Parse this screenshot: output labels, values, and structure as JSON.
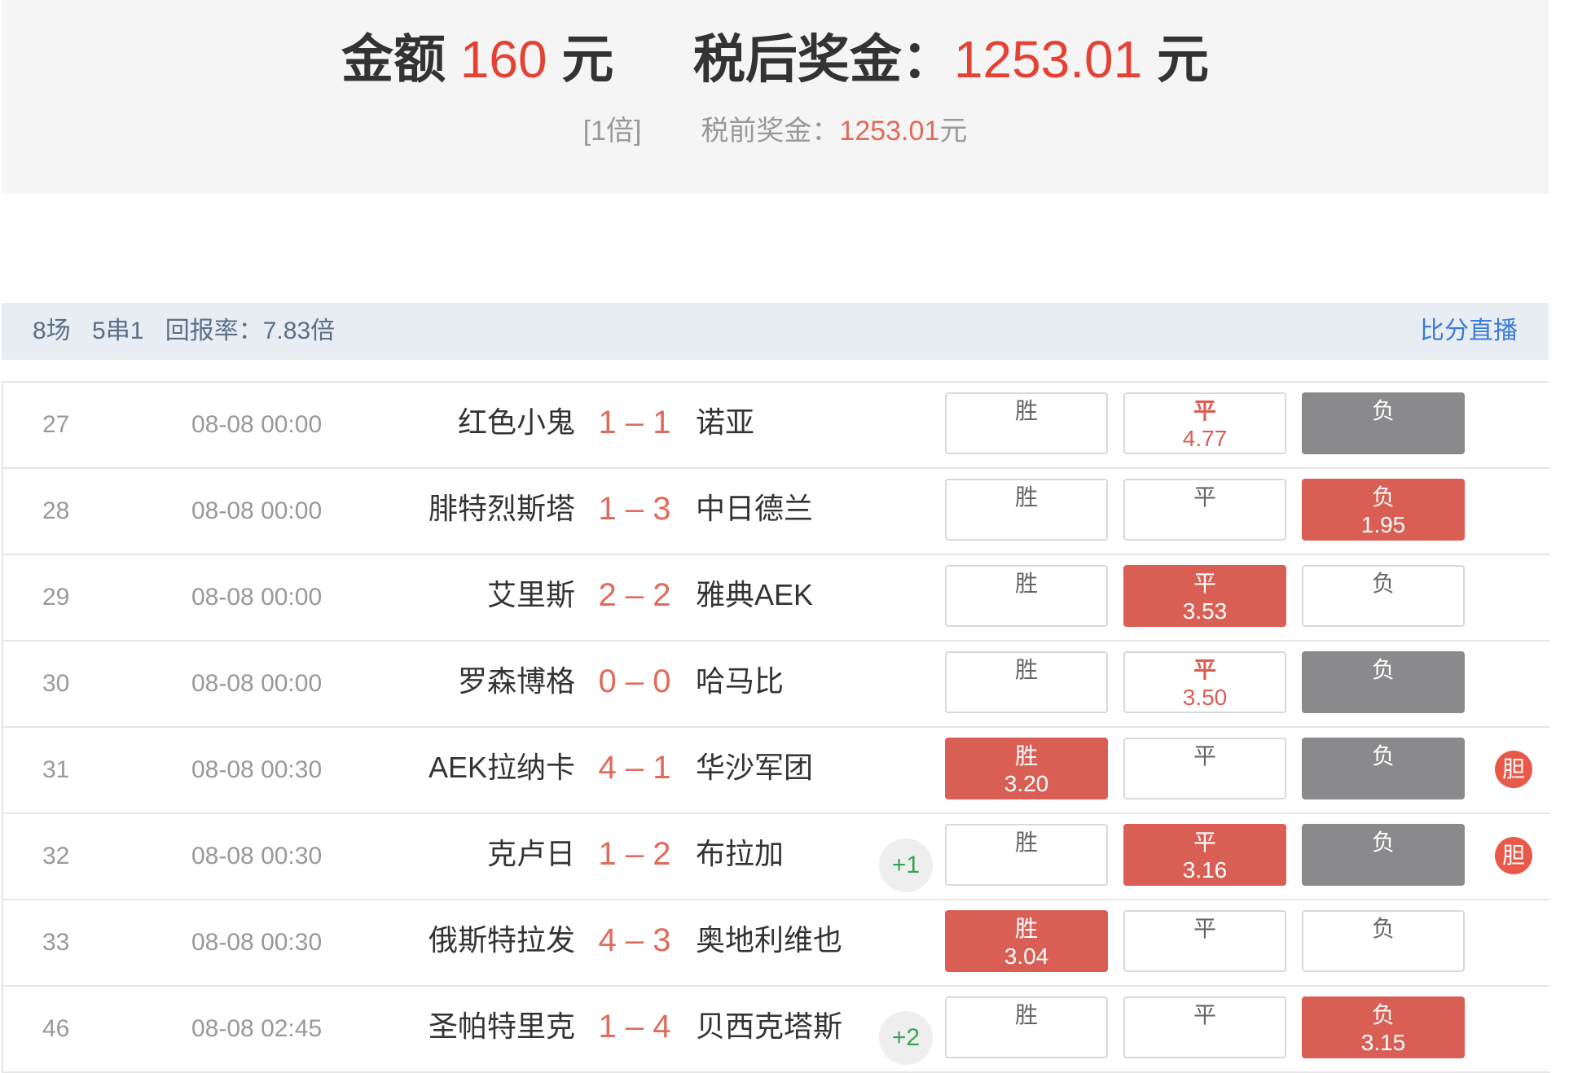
{
  "summary": {
    "amount_label": "金额",
    "amount": "160",
    "amount_unit": "元",
    "after_tax_label": "税后奖金：",
    "after_tax": "1253.01",
    "after_tax_unit": "元",
    "multiple": "[1倍]",
    "pre_tax_label": "税前奖金：",
    "pre_tax": "1253.01",
    "pre_tax_unit": "元"
  },
  "infobar": {
    "matches": "8场",
    "mode": "5串1",
    "return_rate": "回报率：7.83倍",
    "live_link": "比分直播"
  },
  "matches": [
    {
      "num": "27",
      "time": "08-08 00:00",
      "home": "红色小鬼",
      "score": "1 – 1",
      "away": "诺亚",
      "plus": "",
      "win": {
        "label": "胜",
        "odds": "",
        "state": "none"
      },
      "draw": {
        "label": "平",
        "odds": "4.77",
        "state": "odds"
      },
      "lose": {
        "label": "负",
        "odds": "",
        "state": "result"
      },
      "dan": ""
    },
    {
      "num": "28",
      "time": "08-08 00:00",
      "home": "腓特烈斯塔",
      "score": "1 – 3",
      "away": "中日德兰",
      "plus": "",
      "win": {
        "label": "胜",
        "odds": "",
        "state": "none"
      },
      "draw": {
        "label": "平",
        "odds": "",
        "state": "none"
      },
      "lose": {
        "label": "负",
        "odds": "1.95",
        "state": "hit"
      },
      "dan": ""
    },
    {
      "num": "29",
      "time": "08-08 00:00",
      "home": "艾里斯",
      "score": "2 – 2",
      "away": "雅典AEK",
      "plus": "",
      "win": {
        "label": "胜",
        "odds": "",
        "state": "none"
      },
      "draw": {
        "label": "平",
        "odds": "3.53",
        "state": "hit"
      },
      "lose": {
        "label": "负",
        "odds": "",
        "state": "none"
      },
      "dan": ""
    },
    {
      "num": "30",
      "time": "08-08 00:00",
      "home": "罗森博格",
      "score": "0 – 0",
      "away": "哈马比",
      "plus": "",
      "win": {
        "label": "胜",
        "odds": "",
        "state": "none"
      },
      "draw": {
        "label": "平",
        "odds": "3.50",
        "state": "odds"
      },
      "lose": {
        "label": "负",
        "odds": "",
        "state": "result"
      },
      "dan": ""
    },
    {
      "num": "31",
      "time": "08-08 00:30",
      "home": "AEK拉纳卡",
      "score": "4 – 1",
      "away": "华沙军团",
      "plus": "",
      "win": {
        "label": "胜",
        "odds": "3.20",
        "state": "hit"
      },
      "draw": {
        "label": "平",
        "odds": "",
        "state": "none"
      },
      "lose": {
        "label": "负",
        "odds": "",
        "state": "result"
      },
      "dan": "胆"
    },
    {
      "num": "32",
      "time": "08-08 00:30",
      "home": "克卢日",
      "score": "1 – 2",
      "away": "布拉加",
      "plus": "+1",
      "win": {
        "label": "胜",
        "odds": "",
        "state": "none"
      },
      "draw": {
        "label": "平",
        "odds": "3.16",
        "state": "hit"
      },
      "lose": {
        "label": "负",
        "odds": "",
        "state": "result"
      },
      "dan": "胆"
    },
    {
      "num": "33",
      "time": "08-08 00:30",
      "home": "俄斯特拉发",
      "score": "4 – 3",
      "away": "奥地利维也",
      "plus": "",
      "win": {
        "label": "胜",
        "odds": "3.04",
        "state": "hit"
      },
      "draw": {
        "label": "平",
        "odds": "",
        "state": "none"
      },
      "lose": {
        "label": "负",
        "odds": "",
        "state": "none"
      },
      "dan": ""
    },
    {
      "num": "46",
      "time": "08-08 02:45",
      "home": "圣帕特里克",
      "score": "1 – 4",
      "away": "贝西克塔斯",
      "plus": "+2",
      "win": {
        "label": "胜",
        "odds": "",
        "state": "none"
      },
      "draw": {
        "label": "平",
        "odds": "",
        "state": "none"
      },
      "lose": {
        "label": "负",
        "odds": "3.15",
        "state": "hit"
      },
      "dan": ""
    }
  ]
}
